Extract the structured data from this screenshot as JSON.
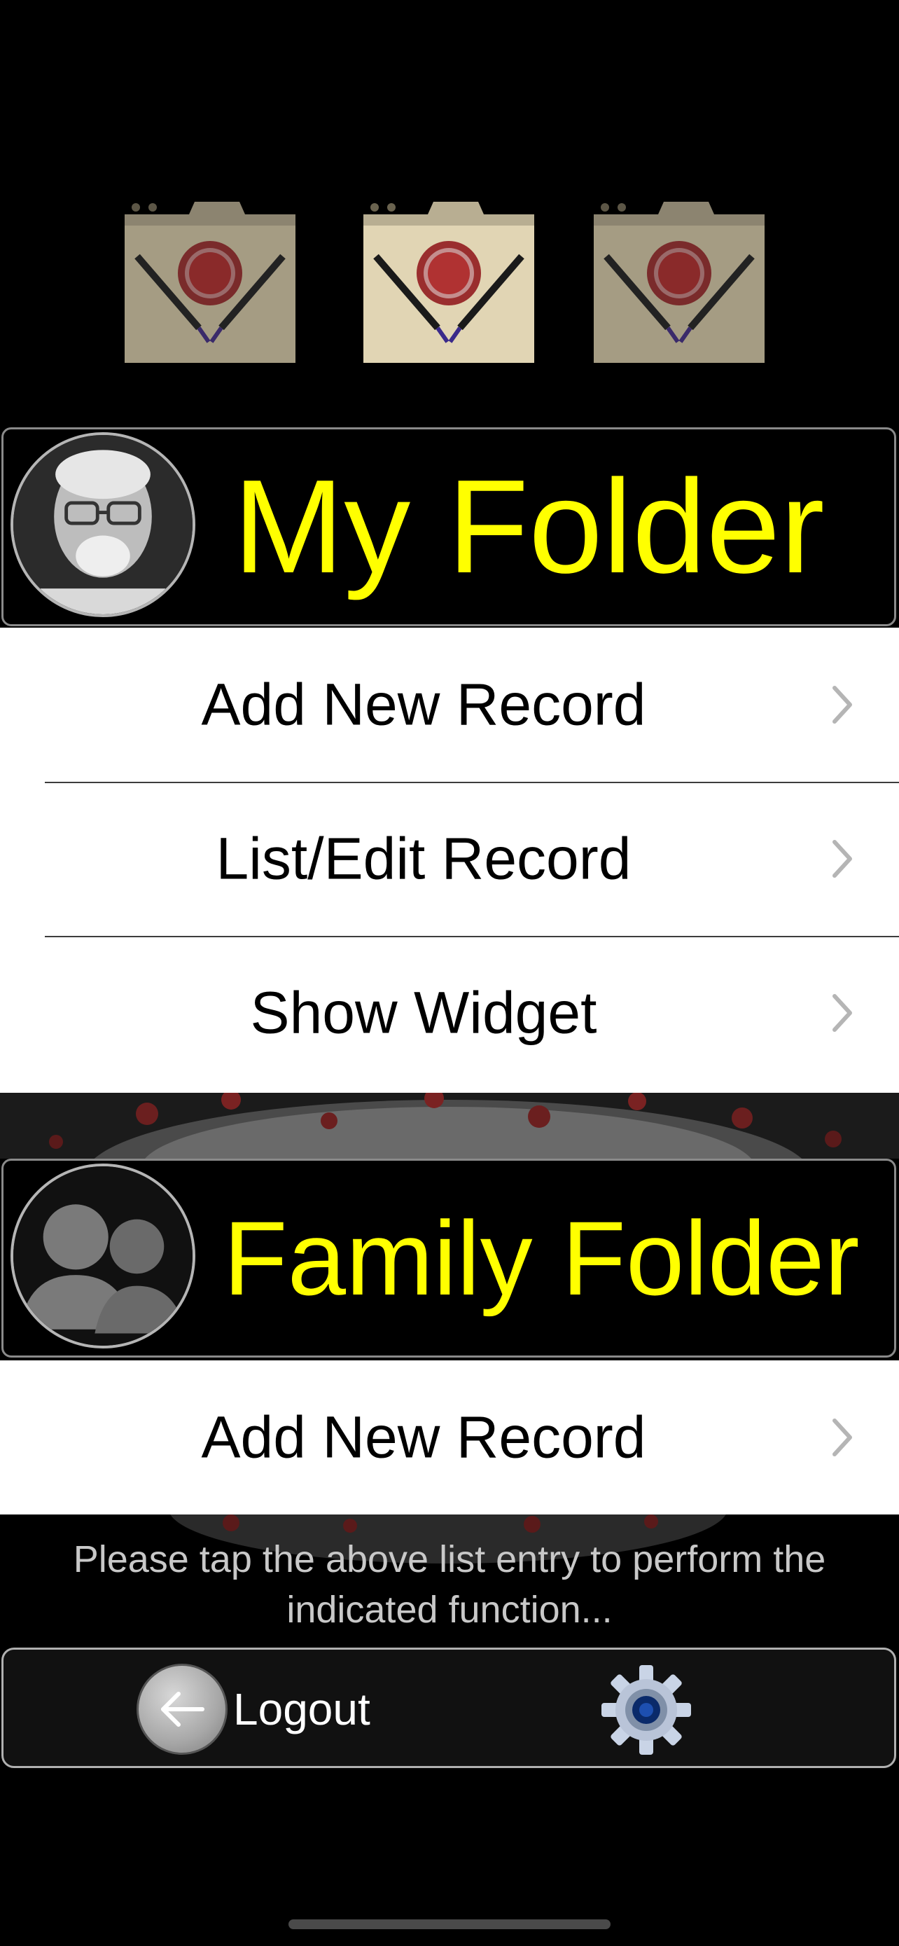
{
  "folder_icons": [
    {
      "icon": "vaccine-folder-icon",
      "state": "dimmed"
    },
    {
      "icon": "vaccine-folder-icon",
      "state": "active"
    },
    {
      "icon": "vaccine-folder-icon",
      "state": "dimmed"
    }
  ],
  "my_folder": {
    "title": "My Folder",
    "avatar": "user-photo-avatar",
    "items": [
      {
        "label": "Add New Record"
      },
      {
        "label": "List/Edit Record"
      },
      {
        "label": "Show Widget"
      }
    ]
  },
  "family_folder": {
    "title": "Family Folder",
    "avatar": "family-placeholder-avatar",
    "items": [
      {
        "label": "Add New Record"
      }
    ]
  },
  "hint": {
    "line1": "Please tap the above list entry to perform the",
    "line2": "indicated function..."
  },
  "toolbar": {
    "logout_label": "Logout",
    "logout_icon": "arrow-left-icon",
    "settings_icon": "gear-icon"
  },
  "colors": {
    "background": "#000000",
    "folder_title": "#ffff00",
    "list_background": "#ffffff",
    "hint_text": "#c8c8c8"
  }
}
